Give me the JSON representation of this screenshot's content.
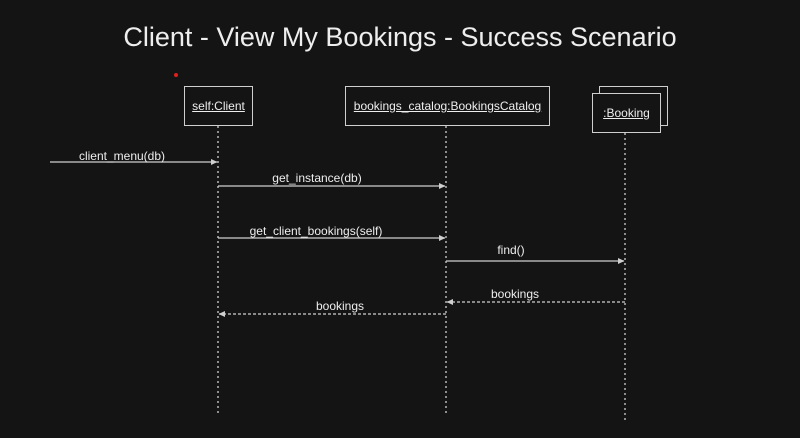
{
  "diagram": {
    "title": "Client - View My Bookings - Success Scenario",
    "lifelines": [
      {
        "id": "client",
        "label": "self:Client"
      },
      {
        "id": "catalog",
        "label": "bookings_catalog:BookingsCatalog"
      },
      {
        "id": "booking",
        "label": ":Booking",
        "multi": true
      }
    ],
    "messages": [
      {
        "label": "client_menu(db)",
        "from": "external",
        "to": "client",
        "style": "solid"
      },
      {
        "label": "get_instance(db)",
        "from": "client",
        "to": "catalog",
        "style": "solid"
      },
      {
        "label": "get_client_bookings(self)",
        "from": "client",
        "to": "catalog",
        "style": "solid"
      },
      {
        "label": "find()",
        "from": "catalog",
        "to": "booking",
        "style": "solid"
      },
      {
        "label": "bookings",
        "from": "booking",
        "to": "catalog",
        "style": "dashed"
      },
      {
        "label": "bookings",
        "from": "catalog",
        "to": "client",
        "style": "dashed"
      }
    ],
    "colors": {
      "background": "#141414",
      "line": "#cfcfcf",
      "text": "#eeeeee",
      "marker": "#e0201e"
    }
  }
}
